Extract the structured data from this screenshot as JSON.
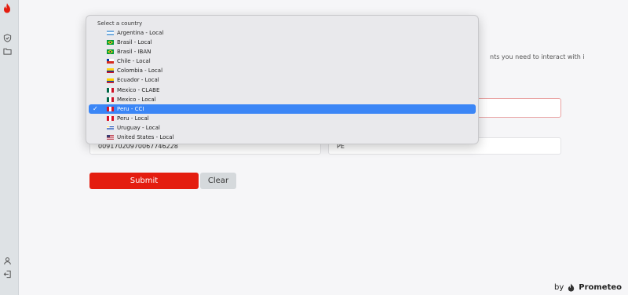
{
  "sidebar": {
    "logo": "prometeo-flame-logo",
    "items": [
      {
        "icon": "shield-icon"
      },
      {
        "icon": "folder-icon"
      }
    ],
    "bottom_items": [
      {
        "icon": "user-icon"
      },
      {
        "icon": "logout-icon"
      }
    ]
  },
  "form": {
    "description_partial": "nts you need to interact with is",
    "account_value": "00917020970067746228",
    "country_code_value": "PE",
    "submit_label": "Submit",
    "clear_label": "Clear"
  },
  "dropdown": {
    "header": "Select a country",
    "selected_index": 8,
    "options": [
      {
        "label": "Argentina - Local",
        "flag": "argentina-flag"
      },
      {
        "label": "Brasil - Local",
        "flag": "brazil-flag"
      },
      {
        "label": "Brasil - IBAN",
        "flag": "brazil-flag"
      },
      {
        "label": "Chile - Local",
        "flag": "chile-flag"
      },
      {
        "label": "Colombia - Local",
        "flag": "colombia-flag"
      },
      {
        "label": "Ecuador - Local",
        "flag": "ecuador-flag"
      },
      {
        "label": "Mexico - CLABE",
        "flag": "mexico-flag"
      },
      {
        "label": "Mexico - Local",
        "flag": "mexico-flag"
      },
      {
        "label": "Peru - CCI",
        "flag": "peru-flag"
      },
      {
        "label": "Peru - Local",
        "flag": "peru-flag"
      },
      {
        "label": "Uruguay - Local",
        "flag": "uruguay-flag"
      },
      {
        "label": "United States - Local",
        "flag": "usa-flag"
      }
    ]
  },
  "footer": {
    "by": "by",
    "brand": "Prometeo"
  },
  "colors": {
    "accent": "#e41d0f",
    "selection": "#3b86f6",
    "sidebar": "#dee2e5"
  }
}
